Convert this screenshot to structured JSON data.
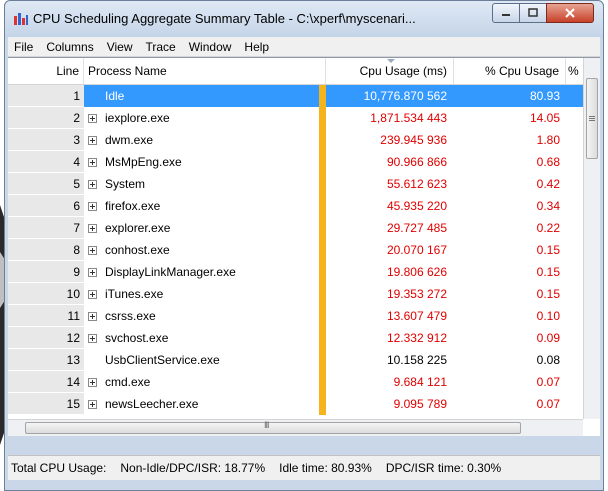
{
  "window": {
    "title": "CPU Scheduling Aggregate Summary Table - C:\\xperf\\myscenari..."
  },
  "menu": [
    "File",
    "Columns",
    "View",
    "Trace",
    "Window",
    "Help"
  ],
  "columns": {
    "line": "Line",
    "process": "Process Name",
    "cpu_usage": "Cpu Usage (ms)",
    "pct_cpu": "% Cpu Usage",
    "extra": "%"
  },
  "rows": [
    {
      "line": "1",
      "name": "Idle",
      "cpu": "10,776.870 562",
      "pct": "80.93",
      "expandable": false,
      "selected": true,
      "red": false
    },
    {
      "line": "2",
      "name": "iexplore.exe",
      "cpu": "1,871.534 443",
      "pct": "14.05",
      "expandable": true,
      "selected": false,
      "red": true
    },
    {
      "line": "3",
      "name": "dwm.exe",
      "cpu": "239.945 936",
      "pct": "1.80",
      "expandable": true,
      "selected": false,
      "red": true
    },
    {
      "line": "4",
      "name": "MsMpEng.exe",
      "cpu": "90.966 866",
      "pct": "0.68",
      "expandable": true,
      "selected": false,
      "red": true
    },
    {
      "line": "5",
      "name": "System",
      "cpu": "55.612 623",
      "pct": "0.42",
      "expandable": true,
      "selected": false,
      "red": true
    },
    {
      "line": "6",
      "name": "firefox.exe",
      "cpu": "45.935 220",
      "pct": "0.34",
      "expandable": true,
      "selected": false,
      "red": true
    },
    {
      "line": "7",
      "name": "explorer.exe",
      "cpu": "29.727 485",
      "pct": "0.22",
      "expandable": true,
      "selected": false,
      "red": true
    },
    {
      "line": "8",
      "name": "conhost.exe",
      "cpu": "20.070 167",
      "pct": "0.15",
      "expandable": true,
      "selected": false,
      "red": true
    },
    {
      "line": "9",
      "name": "DisplayLinkManager.exe",
      "cpu": "19.806 626",
      "pct": "0.15",
      "expandable": true,
      "selected": false,
      "red": true
    },
    {
      "line": "10",
      "name": "iTunes.exe",
      "cpu": "19.353 272",
      "pct": "0.15",
      "expandable": true,
      "selected": false,
      "red": true
    },
    {
      "line": "11",
      "name": "csrss.exe",
      "cpu": "13.607 479",
      "pct": "0.10",
      "expandable": true,
      "selected": false,
      "red": true
    },
    {
      "line": "12",
      "name": "svchost.exe",
      "cpu": "12.332 912",
      "pct": "0.09",
      "expandable": true,
      "selected": false,
      "red": true
    },
    {
      "line": "13",
      "name": "UsbClientService.exe",
      "cpu": "10.158 225",
      "pct": "0.08",
      "expandable": false,
      "selected": false,
      "red": false
    },
    {
      "line": "14",
      "name": "cmd.exe",
      "cpu": "9.684 121",
      "pct": "0.07",
      "expandable": true,
      "selected": false,
      "red": true
    },
    {
      "line": "15",
      "name": "newsLeecher.exe",
      "cpu": "9.095 789",
      "pct": "0.07",
      "expandable": true,
      "selected": false,
      "red": true
    }
  ],
  "scroll_arrow_glyph": "III",
  "status": {
    "total": "Total CPU Usage:",
    "nonidle": "Non-Idle/DPC/ISR: 18.77%",
    "idle": "Idle time: 80.93%",
    "dpc": "DPC/ISR time: 0.30%"
  },
  "colors": {
    "selection": "#3399ff",
    "highlight_text": "#e00000",
    "indicator_bar": "#f5b31c"
  }
}
